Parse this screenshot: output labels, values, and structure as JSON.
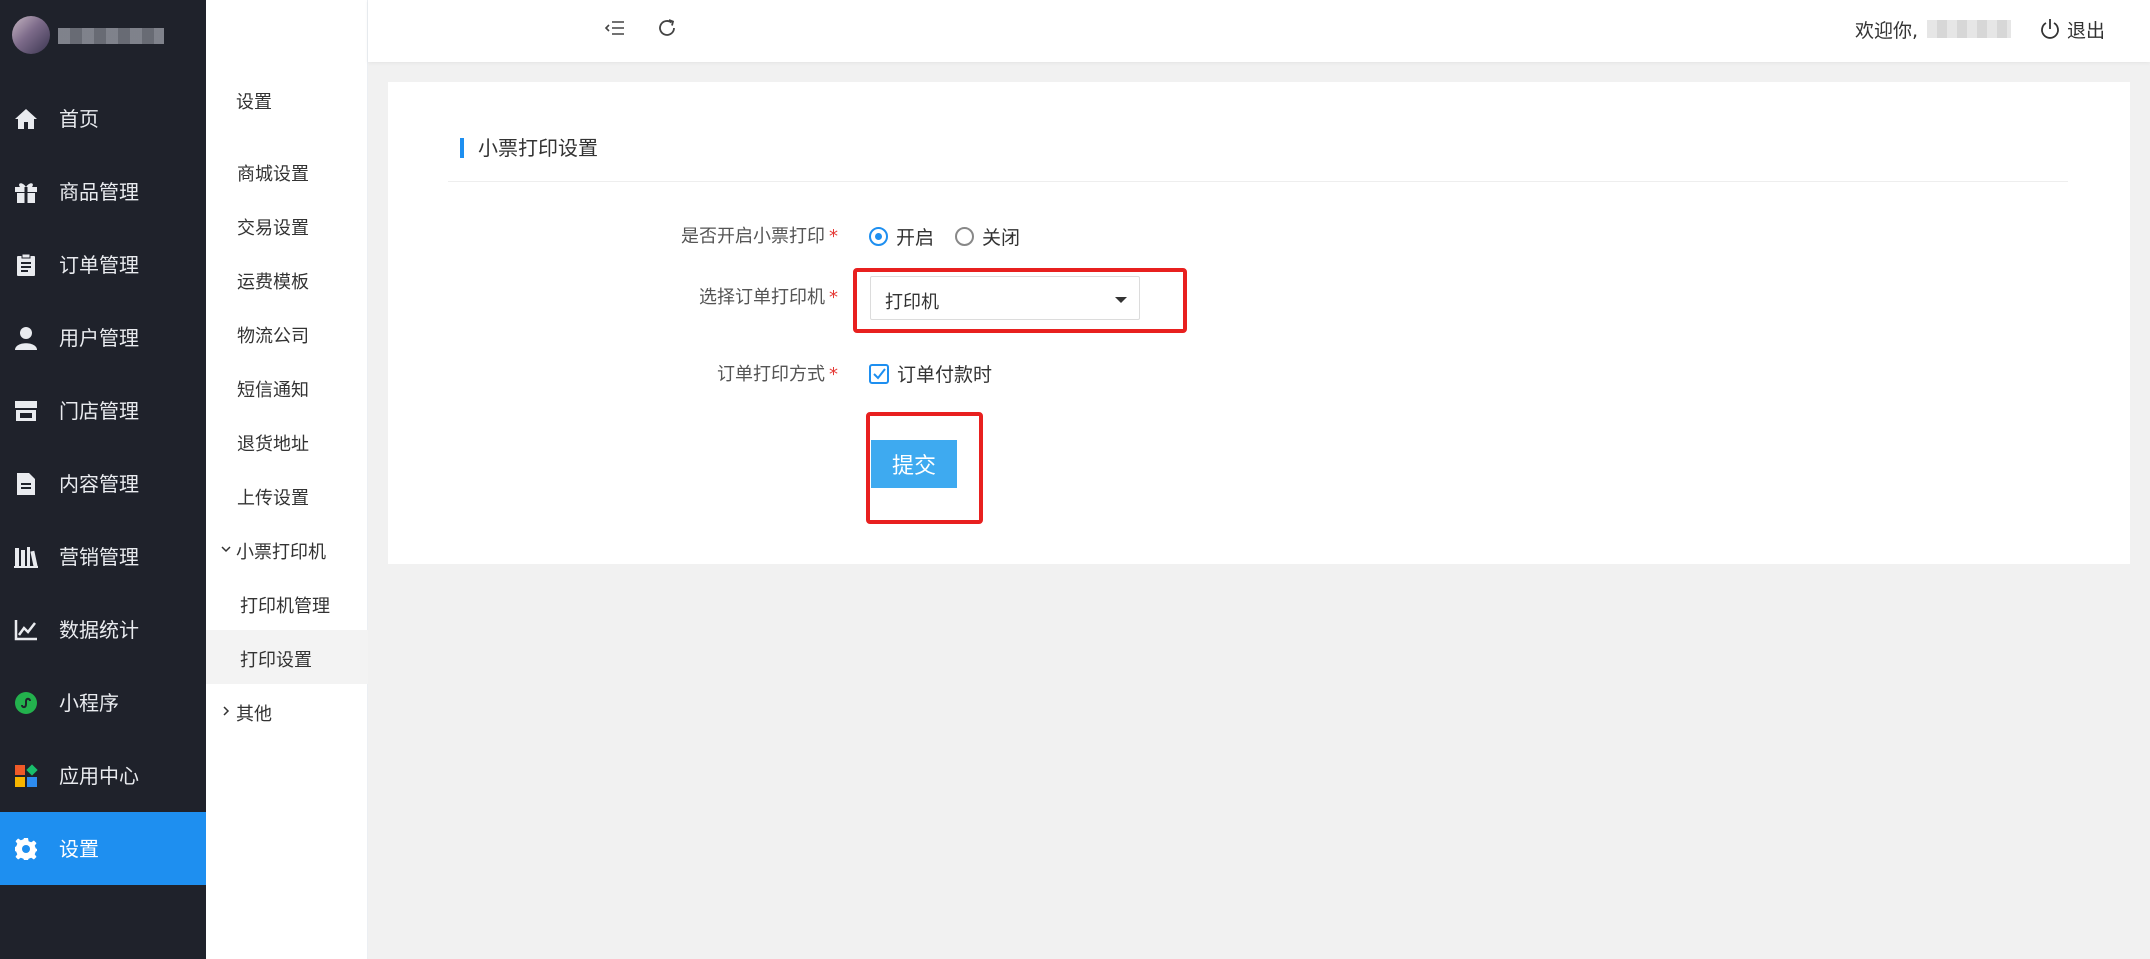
{
  "sidebar": {
    "items": [
      {
        "label": "首页",
        "icon": "home-icon"
      },
      {
        "label": "商品管理",
        "icon": "gift-icon"
      },
      {
        "label": "订单管理",
        "icon": "clipboard-icon"
      },
      {
        "label": "用户管理",
        "icon": "user-icon"
      },
      {
        "label": "门店管理",
        "icon": "store-icon"
      },
      {
        "label": "内容管理",
        "icon": "document-icon"
      },
      {
        "label": "营销管理",
        "icon": "books-icon"
      },
      {
        "label": "数据统计",
        "icon": "chart-icon"
      },
      {
        "label": "小程序",
        "icon": "miniprogram-icon"
      },
      {
        "label": "应用中心",
        "icon": "apps-icon"
      },
      {
        "label": "设置",
        "icon": "gear-icon",
        "active": true
      }
    ]
  },
  "subnav": {
    "title": "设置",
    "items": [
      {
        "label": "商城设置"
      },
      {
        "label": "交易设置"
      },
      {
        "label": "运费模板"
      },
      {
        "label": "物流公司"
      },
      {
        "label": "短信通知"
      },
      {
        "label": "退货地址"
      },
      {
        "label": "上传设置"
      },
      {
        "label": "小票打印机",
        "expanded": true
      },
      {
        "label": "打印机管理",
        "child": true
      },
      {
        "label": "打印设置",
        "child": true,
        "selected": true
      },
      {
        "label": "其他",
        "collapsed": true
      }
    ]
  },
  "topbar": {
    "welcome": "欢迎你,",
    "logout": "退出"
  },
  "form": {
    "section_title": "小票打印设置",
    "enable_label": "是否开启小票打印",
    "enable_on": "开启",
    "enable_off": "关闭",
    "printer_label": "选择订单打印机",
    "printer_value": "打印机",
    "mode_label": "订单打印方式",
    "mode_option": "订单付款时",
    "submit": "提交",
    "required_mark": "*"
  },
  "colors": {
    "sidebar_bg": "#1f222b",
    "active_blue": "#1e8ff0",
    "button_blue": "#3eaaf0",
    "highlight_red": "#e8201f",
    "required_red": "#e53935"
  }
}
